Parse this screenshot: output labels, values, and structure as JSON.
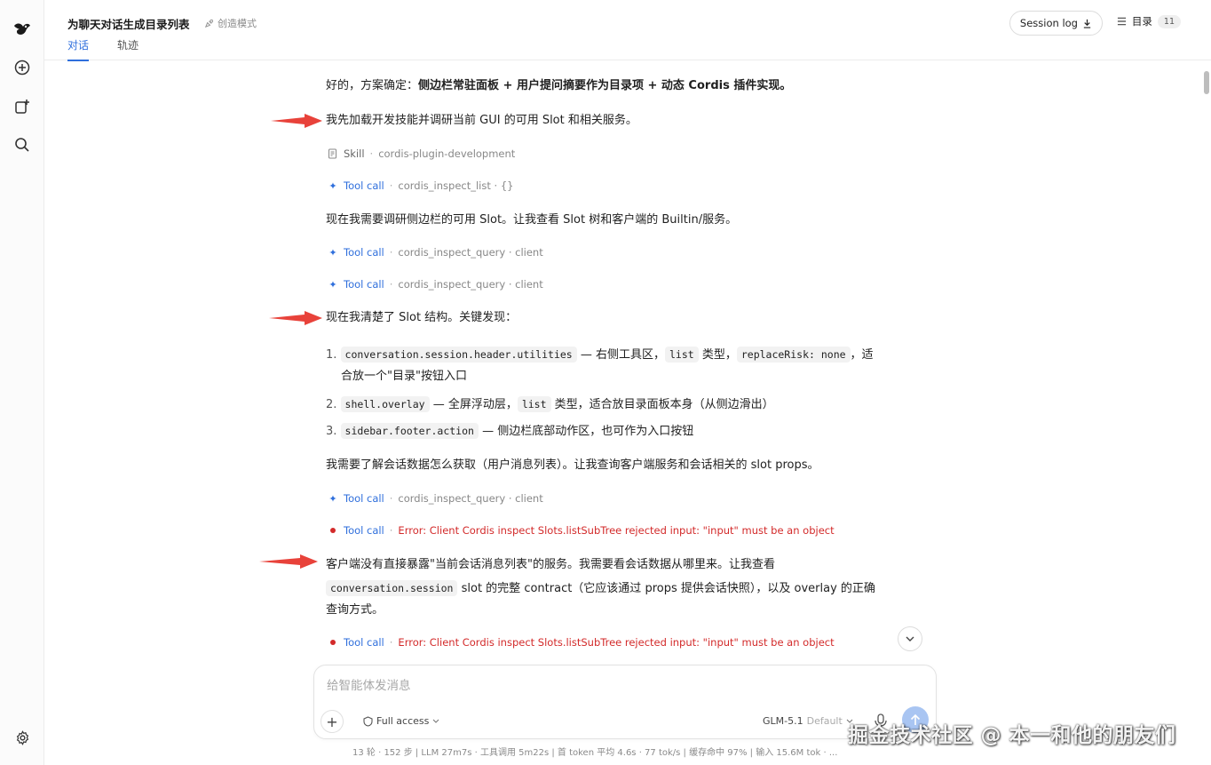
{
  "header": {
    "title": "为聊天对话生成目录列表",
    "mode": "创造模式",
    "tabs": [
      {
        "label": "对话"
      },
      {
        "label": "轨迹"
      }
    ],
    "session_log": "Session log",
    "toc_label": "目录",
    "toc_count": "11"
  },
  "messages": {
    "m1_pre": "好的，方案确定：",
    "m1_bold": "侧边栏常驻面板 + 用户提问摘要作为目录项 + 动态 Cordis 插件实现。",
    "m2": "我先加载开发技能并调研当前 GUI 的可用 Slot 和相关服务。",
    "skill": {
      "label": "Skill",
      "name": "cordis-plugin-development"
    },
    "tool1": {
      "label": "Tool call",
      "detail": "cordis_inspect_list · {}"
    },
    "m3": "现在我需要调研侧边栏的可用 Slot。让我查看 Slot 树和客户端的 Builtin/服务。",
    "tool2": {
      "label": "Tool call",
      "detail": "cordis_inspect_query · client"
    },
    "tool3": {
      "label": "Tool call",
      "detail": "cordis_inspect_query · client"
    },
    "m4": "现在我清楚了 Slot 结构。关键发现：",
    "list": [
      {
        "num": "1.",
        "code": "conversation.session.header.utilities",
        "t1": " — 右侧工具区，",
        "code2": "list",
        "t2": " 类型，",
        "code3": "replaceRisk: none",
        "t3": "，适",
        "t4": "合放一个\"目录\"按钮入口"
      },
      {
        "num": "2.",
        "code": "shell.overlay",
        "t1": " — 全屏浮动层，",
        "code2": "list",
        "t2": " 类型，适合放目录面板本身（从侧边滑出）"
      },
      {
        "num": "3.",
        "code": "sidebar.footer.action",
        "t1": " — 侧边栏底部动作区，也可作为入口按钮"
      }
    ],
    "m5": "我需要了解会话数据怎么获取（用户消息列表）。让我查询客户端服务和会话相关的 slot props。",
    "tool4": {
      "label": "Tool call",
      "detail": "cordis_inspect_query · client"
    },
    "tool5": {
      "label": "Tool call",
      "error": "Error: Client Cordis inspect Slots.listSubTree rejected input: \"input\" must be an object"
    },
    "m6_line1": "客户端没有直接暴露\"当前会话消息列表\"的服务。我需要看会话数据从哪里来。让我查看",
    "m6_code": "conversation.session",
    "m6_line2": " slot 的完整 contract（它应该通过 props 提供会话快照），以及 overlay 的正确",
    "m6_line3": "查询方式。",
    "tool6": {
      "label": "Tool call",
      "error": "Error: Client Cordis inspect Slots.listSubTree rejected input: \"input\" must be an object"
    }
  },
  "composer": {
    "placeholder": "给智能体发消息",
    "access": "Full access",
    "model": "GLM-5.1",
    "model_variant": "Default"
  },
  "stats": "13 轮 · 152 步   |   LLM 27m7s · 工具调用 5m22s   |   首 token 平均 4.6s · 77 tok/s   |   缓存命中 97%   |   输入 15.6M tok · ...",
  "watermark": "掘金技术社区 @ 本一和他的朋友们",
  "colors": {
    "accent": "#2f6fdc",
    "error": "#d32a2a",
    "arrow": "#e8423a"
  }
}
